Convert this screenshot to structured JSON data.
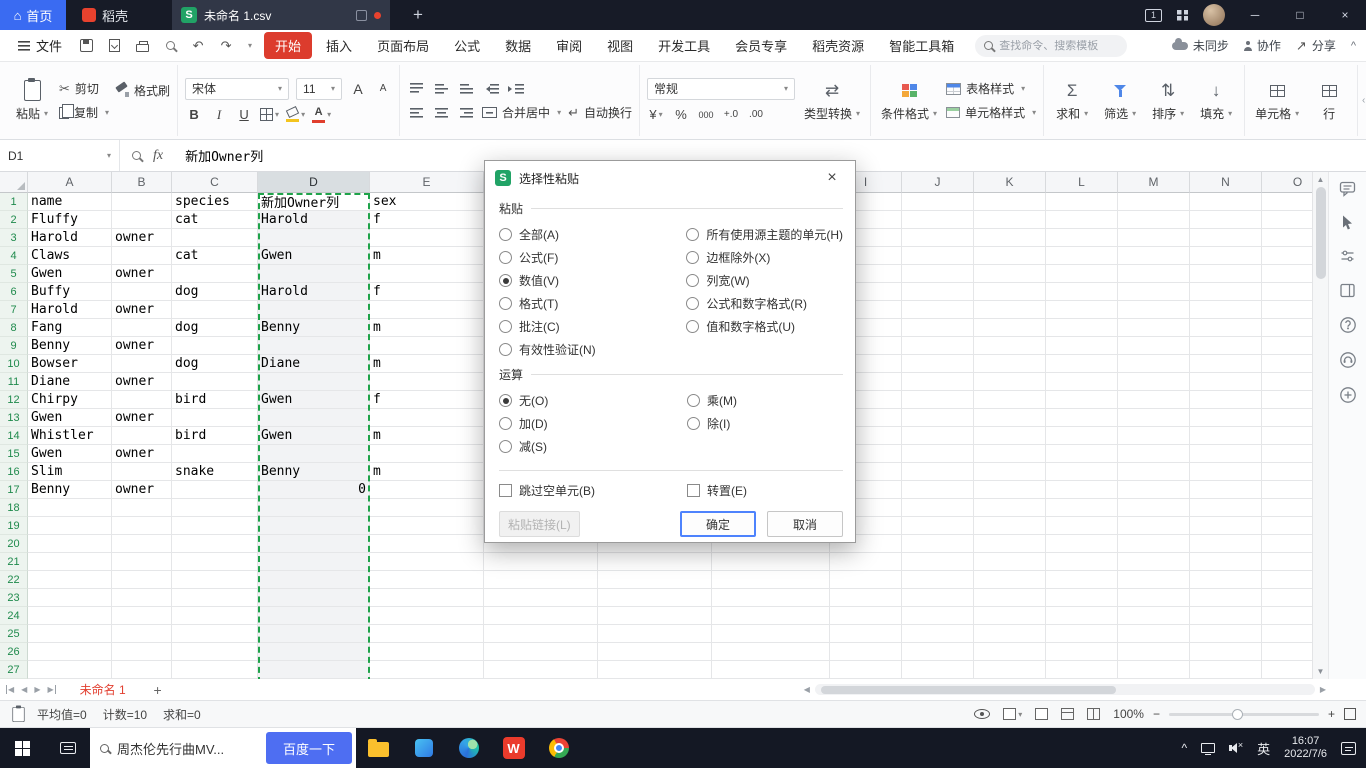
{
  "titlebar": {
    "home_label": "首页",
    "docer_label": "稻壳",
    "doc_tab_title": "未命名 1.csv"
  },
  "menubar": {
    "file_label": "文件",
    "tabs": [
      "开始",
      "插入",
      "页面布局",
      "公式",
      "数据",
      "审阅",
      "视图",
      "开发工具",
      "会员专享",
      "稻壳资源",
      "智能工具箱"
    ],
    "active_tab": "开始",
    "search_placeholder": "查找命令、搜索模板",
    "sync_label": "未同步",
    "collab_label": "协作",
    "share_label": "分享"
  },
  "toolbar": {
    "paste_label": "粘贴",
    "cut_label": "剪切",
    "copy_label": "复制",
    "format_painter_label": "格式刷",
    "font_name": "宋体",
    "font_size": "11",
    "merge_center_label": "合并居中",
    "wrap_text_label": "自动换行",
    "number_format": "常规",
    "type_convert_label": "类型转换",
    "conditional_format_label": "条件格式",
    "table_style_label": "表格样式",
    "cell_style_label": "单元格样式",
    "sum_label": "求和",
    "filter_label": "筛选",
    "sort_label": "排序",
    "fill_label": "填充",
    "cells_label": "单元格",
    "rows_label": "行"
  },
  "formula_bar": {
    "cell_ref": "D1",
    "fx_label": "fx",
    "content": "新加Owner列"
  },
  "grid": {
    "selected_column": "D",
    "active_cell": "D1",
    "row_count": 27,
    "columns": [
      "A",
      "B",
      "C",
      "D",
      "E",
      "F",
      "G",
      "H",
      "I",
      "J",
      "K",
      "L",
      "M",
      "N",
      "O"
    ],
    "rows": [
      {
        "n": 1,
        "cells": {
          "A": "name",
          "C": "species",
          "D": "新加Owner列",
          "E": "sex"
        }
      },
      {
        "n": 2,
        "cells": {
          "A": "Fluffy",
          "C": "cat",
          "D": "Harold",
          "E": "f"
        }
      },
      {
        "n": 3,
        "cells": {
          "A": "Harold",
          "B": "owner"
        }
      },
      {
        "n": 4,
        "cells": {
          "A": "Claws",
          "C": "cat",
          "D": "Gwen",
          "E": "m"
        }
      },
      {
        "n": 5,
        "cells": {
          "A": "Gwen",
          "B": "owner"
        }
      },
      {
        "n": 6,
        "cells": {
          "A": "Buffy",
          "C": "dog",
          "D": "Harold",
          "E": "f"
        }
      },
      {
        "n": 7,
        "cells": {
          "A": "Harold",
          "B": "owner"
        }
      },
      {
        "n": 8,
        "cells": {
          "A": "Fang",
          "C": "dog",
          "D": "Benny",
          "E": "m"
        }
      },
      {
        "n": 9,
        "cells": {
          "A": "Benny",
          "B": "owner"
        }
      },
      {
        "n": 10,
        "cells": {
          "A": "Bowser",
          "C": "dog",
          "D": "Diane",
          "E": "m"
        }
      },
      {
        "n": 11,
        "cells": {
          "A": "Diane",
          "B": "owner"
        }
      },
      {
        "n": 12,
        "cells": {
          "A": "Chirpy",
          "C": "bird",
          "D": "Gwen",
          "E": "f"
        }
      },
      {
        "n": 13,
        "cells": {
          "A": "Gwen",
          "B": "owner"
        }
      },
      {
        "n": 14,
        "cells": {
          "A": "Whistler",
          "C": "bird",
          "D": "Gwen",
          "E": "m"
        }
      },
      {
        "n": 15,
        "cells": {
          "A": "Gwen",
          "B": "owner"
        }
      },
      {
        "n": 16,
        "cells": {
          "A": "Slim",
          "C": "snake",
          "D": "Benny",
          "E": "m"
        }
      },
      {
        "n": 17,
        "cells": {
          "A": "Benny",
          "B": "owner",
          "D": "0"
        },
        "align": {
          "D": "right"
        }
      }
    ]
  },
  "dialog": {
    "title": "选择性粘贴",
    "groups": [
      {
        "label": "粘贴",
        "left": [
          {
            "label": "全部(A)",
            "selected": false
          },
          {
            "label": "公式(F)",
            "selected": false
          },
          {
            "label": "数值(V)",
            "selected": true
          },
          {
            "label": "格式(T)",
            "selected": false
          },
          {
            "label": "批注(C)",
            "selected": false
          },
          {
            "label": "有效性验证(N)",
            "selected": false
          }
        ],
        "right": [
          {
            "label": "所有使用源主题的单元(H)",
            "selected": false
          },
          {
            "label": "边框除外(X)",
            "selected": false
          },
          {
            "label": "列宽(W)",
            "selected": false
          },
          {
            "label": "公式和数字格式(R)",
            "selected": false
          },
          {
            "label": "值和数字格式(U)",
            "selected": false
          }
        ]
      },
      {
        "label": "运算",
        "left": [
          {
            "label": "无(O)",
            "selected": true
          },
          {
            "label": "加(D)",
            "selected": false
          },
          {
            "label": "减(S)",
            "selected": false
          }
        ],
        "right": [
          {
            "label": "乘(M)",
            "selected": false
          },
          {
            "label": "除(I)",
            "selected": false
          }
        ]
      }
    ],
    "checkboxes": [
      {
        "label": "跳过空单元(B)",
        "checked": false
      },
      {
        "label": "转置(E)",
        "checked": false
      }
    ],
    "buttons": [
      {
        "label": "粘贴链接(L)",
        "disabled": true
      },
      {
        "label": "确定",
        "primary": true
      },
      {
        "label": "取消"
      }
    ]
  },
  "sheet_bar": {
    "sheet_name": "未命名 1"
  },
  "status_bar": {
    "stats": [
      "平均值=0",
      "计数=10",
      "求和=0"
    ],
    "zoom_level": "100%"
  },
  "taskbar": {
    "search_text": "周杰伦先行曲MV...",
    "search_button_label": "百度一下",
    "ime_label": "英",
    "time": "16:07",
    "date": "2022/7/6"
  },
  "icons": {
    "home": "⌂",
    "dropdown": "▾",
    "new_tab": "+",
    "minimize": "─",
    "maximize": "□",
    "close": "×",
    "undo": "↶",
    "redo": "↷",
    "cut": "✂",
    "sum": "Σ",
    "currency": "¥",
    "percent": "%",
    "thousands": "000",
    "add_decimal": "+.0",
    "remove_decimal": ".00",
    "type_convert": "⇄",
    "sort": "⇅",
    "fill": "↓",
    "wrap": "↵",
    "share": "↗",
    "chevron_up": "^",
    "collapse_left": "‹",
    "s_logo": "S",
    "window_badge": "1",
    "wps_w": "W",
    "bold": "B",
    "italic": "I",
    "underline": "U",
    "font_color": "A",
    "grow_font": "A",
    "shrink_font": "A",
    "scroll_up": "▲",
    "scroll_down": "▼",
    "nav_prev": "◀",
    "nav_next": "▶",
    "zoom_minus": "−",
    "zoom_plus": "+"
  },
  "colors": {
    "titlebar_bg": "#171b27",
    "active_menu_tab_red": "#dc3c2d",
    "wps_green": "#21a366",
    "selection_green": "#1fa34a",
    "primary_button_blue": "#4e83fd",
    "baidu_blue": "#4e6ef2",
    "home_button_blue": "#3a6bf2",
    "sheet_tab_red": "#e23f30"
  }
}
